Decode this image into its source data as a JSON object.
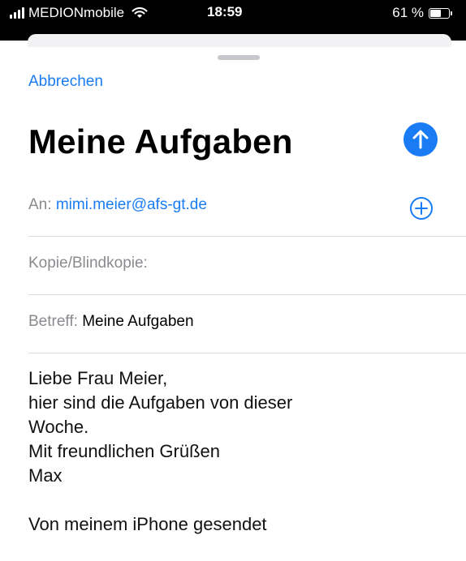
{
  "status_bar": {
    "carrier": "MEDIONmobile",
    "time": "18:59",
    "battery_percent": "61 %",
    "battery_level": 0.61
  },
  "compose": {
    "cancel_label": "Abbrechen",
    "title": "Meine Aufgaben",
    "send_icon": "arrow-up-circle-icon",
    "to_label": "An:",
    "to_value": "mimi.meier@afs-gt.de",
    "add_recipient_icon": "plus-circle-icon",
    "cc_label": "Kopie/Blindkopie:",
    "subject_label": "Betreff:",
    "subject_value": "Meine Aufgaben",
    "body_lines": [
      "Liebe Frau Meier,",
      "hier sind die Aufgaben von dieser",
      "Woche.",
      "Mit freundlichen Grüßen",
      "Max",
      "",
      "Von meinem iPhone gesendet"
    ]
  },
  "colors": {
    "accent": "#1a7cf5",
    "label_gray": "#8a8a8f"
  }
}
